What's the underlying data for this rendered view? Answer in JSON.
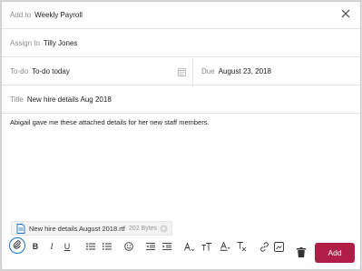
{
  "header": {
    "add_to_label": "Add to",
    "add_to_value": "Weekly Payroll"
  },
  "assign": {
    "label": "Assign to",
    "value": "Tilly Jones"
  },
  "todo": {
    "label": "To-do",
    "value": "To-do today"
  },
  "due": {
    "label": "Due",
    "value": "August 23, 2018"
  },
  "title": {
    "label": "Title",
    "value": "New hire details Aug 2018"
  },
  "body": {
    "text": "Abigail gave me these attached details for her new staff members."
  },
  "attachment": {
    "filename": "New hire details August 2018.rtf",
    "size": "202 Bytes"
  },
  "toolbar": {
    "bold": "B",
    "italic": "I",
    "underline": "U",
    "add_label": "Add"
  },
  "colors": {
    "accent_button": "#b01e48",
    "focus_ring": "#1a73c9"
  }
}
